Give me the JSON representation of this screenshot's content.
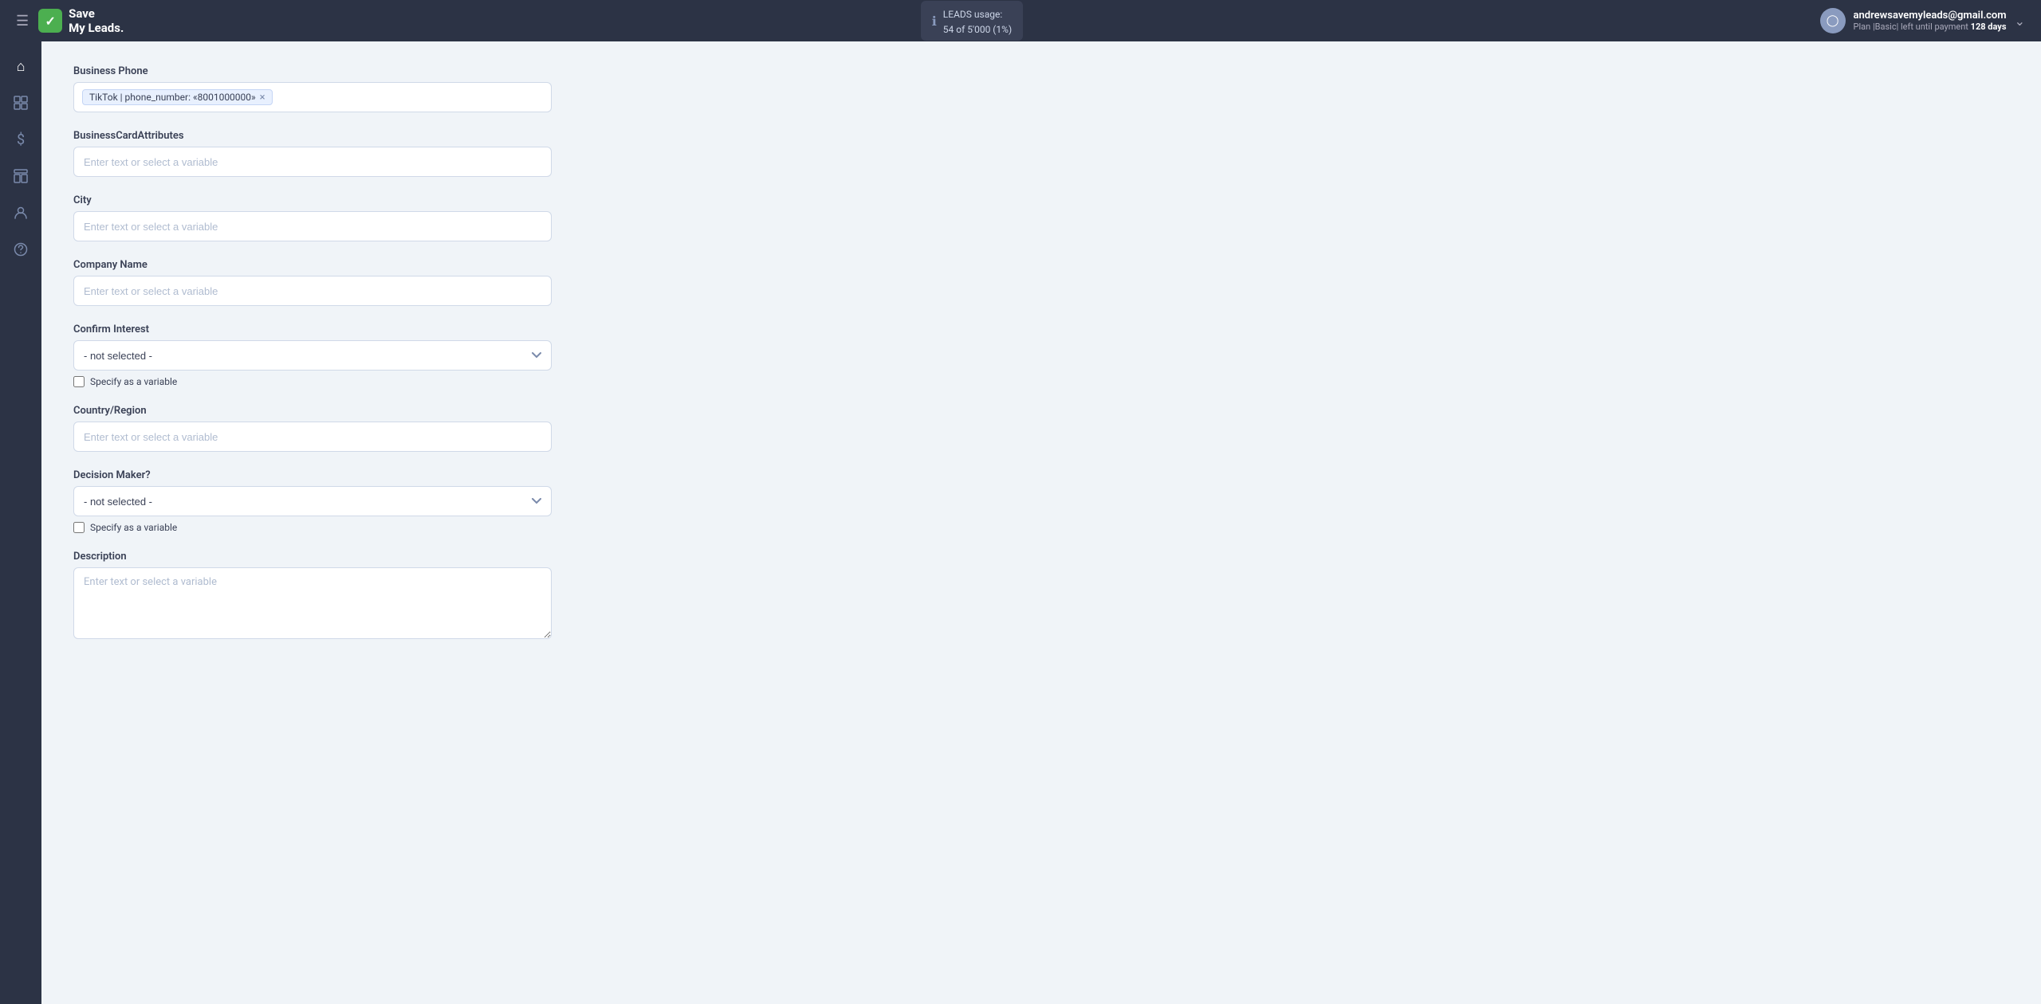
{
  "topbar": {
    "hamburger_label": "☰",
    "logo_check": "✓",
    "logo_name": "Save\nMy Leads.",
    "leads_usage_label": "LEADS usage:",
    "leads_usage_value": "54 of 5'000 (1%)",
    "info_icon": "ℹ",
    "user_email": "andrewsavemyleads@gmail.com",
    "plan_text": "Plan |Basic| left until payment",
    "plan_days": "128 days",
    "chevron": "⌄"
  },
  "sidebar": {
    "items": [
      {
        "icon": "⌂",
        "name": "home"
      },
      {
        "icon": "⊞",
        "name": "integrations"
      },
      {
        "icon": "$",
        "name": "billing"
      },
      {
        "icon": "🗂",
        "name": "templates"
      },
      {
        "icon": "◯",
        "name": "account"
      },
      {
        "icon": "?",
        "name": "help"
      }
    ]
  },
  "form": {
    "business_phone": {
      "label": "Business Phone",
      "tag_text": "TikTok | phone_number: «8001000000»",
      "tag_close": "×"
    },
    "business_card_attributes": {
      "label": "BusinessCardAttributes",
      "placeholder": "Enter text or select a variable"
    },
    "city": {
      "label": "City",
      "placeholder": "Enter text or select a variable"
    },
    "company_name": {
      "label": "Company Name",
      "placeholder": "Enter text or select a variable"
    },
    "confirm_interest": {
      "label": "Confirm Interest",
      "default_option": "- not selected -",
      "options": [
        "- not selected -"
      ],
      "specify_variable_label": "Specify as a variable"
    },
    "country_region": {
      "label": "Country/Region",
      "placeholder": "Enter text or select a variable"
    },
    "decision_maker": {
      "label": "Decision Maker?",
      "default_option": "- not selected -",
      "options": [
        "- not selected -"
      ],
      "specify_variable_label": "Specify as a variable"
    },
    "description": {
      "label": "Description",
      "placeholder": "Enter text or select a variable"
    }
  }
}
